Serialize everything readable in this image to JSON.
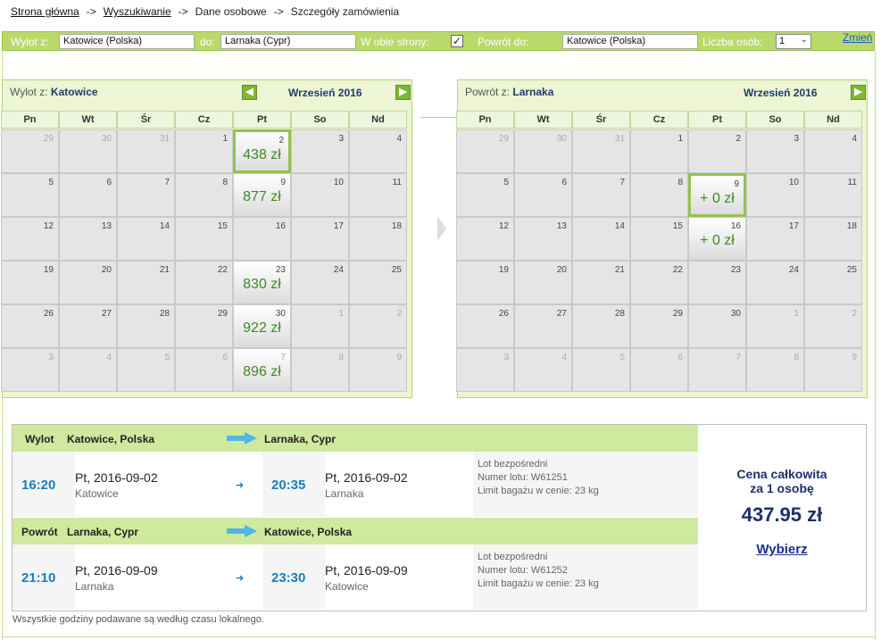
{
  "breadcrumb": {
    "home": "Strona główna",
    "search": "Wyszukiwanie",
    "personal": "Dane osobowe",
    "details": "Szczegóły zamówienia",
    "sep": "->"
  },
  "searchbar": {
    "from_label": "Wylot z:",
    "from_value": "Katowice (Polska)",
    "to_label": "do:",
    "to_value": "Larnaka (Cypr)",
    "roundtrip_label": "W obie strony:",
    "roundtrip_checked": "✓",
    "return_label": "Powrót do:",
    "return_value": "Katowice (Polska)",
    "persons_label": "Liczba osób:",
    "persons_value": "1",
    "change_link": "Zmień"
  },
  "weekdays": [
    "Pn",
    "Wt",
    "Śr",
    "Cz",
    "Pt",
    "So",
    "Nd"
  ],
  "outbound_calendar": {
    "title_prefix": "Wylot z:",
    "title_city": "Katowice",
    "month": "Wrzesień 2016",
    "prev_icon": "arrow-left-icon",
    "next_icon": "arrow-right-icon",
    "accent": "#7fb636",
    "days": [
      {
        "n": "29",
        "dim": true
      },
      {
        "n": "30",
        "dim": true
      },
      {
        "n": "31",
        "dim": true
      },
      {
        "n": "1"
      },
      {
        "n": "2",
        "price": "438 zł",
        "selected": true
      },
      {
        "n": "3"
      },
      {
        "n": "4"
      },
      {
        "n": "5"
      },
      {
        "n": "6"
      },
      {
        "n": "7"
      },
      {
        "n": "8"
      },
      {
        "n": "9",
        "price": "877 zł"
      },
      {
        "n": "10"
      },
      {
        "n": "11"
      },
      {
        "n": "12"
      },
      {
        "n": "13"
      },
      {
        "n": "14"
      },
      {
        "n": "15"
      },
      {
        "n": "16"
      },
      {
        "n": "17"
      },
      {
        "n": "18"
      },
      {
        "n": "19"
      },
      {
        "n": "20"
      },
      {
        "n": "21"
      },
      {
        "n": "22"
      },
      {
        "n": "23",
        "price": "830 zł"
      },
      {
        "n": "24"
      },
      {
        "n": "25"
      },
      {
        "n": "26"
      },
      {
        "n": "27"
      },
      {
        "n": "28"
      },
      {
        "n": "29"
      },
      {
        "n": "30",
        "price": "922 zł"
      },
      {
        "n": "1",
        "dim": true
      },
      {
        "n": "2",
        "dim": true
      },
      {
        "n": "3",
        "dim": true
      },
      {
        "n": "4",
        "dim": true
      },
      {
        "n": "5",
        "dim": true
      },
      {
        "n": "6",
        "dim": true
      },
      {
        "n": "7",
        "dim": true,
        "price": "896 zł"
      },
      {
        "n": "8",
        "dim": true
      },
      {
        "n": "9",
        "dim": true
      }
    ]
  },
  "return_calendar": {
    "title_prefix": "Powrót z:",
    "title_city": "Larnaka",
    "month": "Wrzesień 2016",
    "next_icon": "arrow-right-icon",
    "days": [
      {
        "n": "29",
        "dim": true
      },
      {
        "n": "30",
        "dim": true
      },
      {
        "n": "31",
        "dim": true
      },
      {
        "n": "1"
      },
      {
        "n": "2"
      },
      {
        "n": "3"
      },
      {
        "n": "4"
      },
      {
        "n": "5"
      },
      {
        "n": "6"
      },
      {
        "n": "7"
      },
      {
        "n": "8"
      },
      {
        "n": "9",
        "price": "+ 0 zł",
        "selected": true
      },
      {
        "n": "10"
      },
      {
        "n": "11"
      },
      {
        "n": "12"
      },
      {
        "n": "13"
      },
      {
        "n": "14"
      },
      {
        "n": "15"
      },
      {
        "n": "16",
        "price": "+ 0 zł"
      },
      {
        "n": "17"
      },
      {
        "n": "18"
      },
      {
        "n": "19"
      },
      {
        "n": "20"
      },
      {
        "n": "21"
      },
      {
        "n": "22"
      },
      {
        "n": "23"
      },
      {
        "n": "24"
      },
      {
        "n": "25"
      },
      {
        "n": "26"
      },
      {
        "n": "27"
      },
      {
        "n": "28"
      },
      {
        "n": "29"
      },
      {
        "n": "30"
      },
      {
        "n": "1",
        "dim": true
      },
      {
        "n": "2",
        "dim": true
      },
      {
        "n": "3",
        "dim": true
      },
      {
        "n": "4",
        "dim": true
      },
      {
        "n": "5",
        "dim": true
      },
      {
        "n": "6",
        "dim": true
      },
      {
        "n": "7",
        "dim": true
      },
      {
        "n": "8",
        "dim": true
      },
      {
        "n": "9",
        "dim": true
      }
    ]
  },
  "summary": {
    "outbound": {
      "label": "Wylot",
      "from": "Katowice, Polska",
      "to": "Larnaka, Cypr",
      "dep_time": "16:20",
      "dep_date": "Pt, 2016-09-02",
      "dep_city": "Katowice",
      "arr_time": "20:35",
      "arr_date": "Pt, 2016-09-02",
      "arr_city": "Larnaka",
      "direct": "Lot bezpośredni",
      "flight_no": "Numer lotu: W61251",
      "baggage": "Limit bagażu w cenie: 23 kg"
    },
    "return": {
      "label": "Powrót",
      "from": "Larnaka, Cypr",
      "to": "Katowice, Polska",
      "dep_time": "21:10",
      "dep_date": "Pt, 2016-09-09",
      "dep_city": "Larnaka",
      "arr_time": "23:30",
      "arr_date": "Pt, 2016-09-09",
      "arr_city": "Katowice",
      "direct": "Lot bezpośredni",
      "flight_no": "Numer lotu: W61252",
      "baggage": "Limit bagażu w cenie: 23 kg"
    },
    "total_line1": "Cena całkowita",
    "total_line2": "za 1 osobę",
    "total_price": "437.95 zł",
    "select_link": "Wybierz"
  },
  "footer_note": "Wszystkie godziny podawane są według czasu lokalnego."
}
